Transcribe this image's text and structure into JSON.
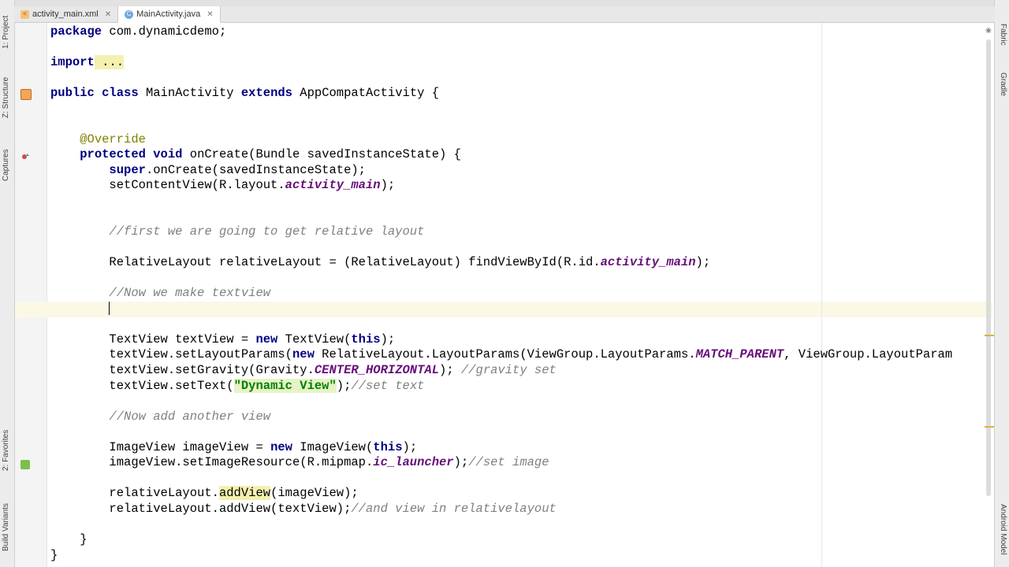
{
  "tabs": [
    {
      "label": "activity_main.xml",
      "icon": "xml-file-icon",
      "active": false
    },
    {
      "label": "MainActivity.java",
      "icon": "java-class-icon",
      "active": true
    }
  ],
  "left_tool_windows": [
    "1: Project",
    "Z: Structure",
    "Captures",
    "2: Favorites",
    "Build Variants"
  ],
  "right_tool_windows": [
    "Fabric",
    "Gradle",
    "Android Model"
  ],
  "code": {
    "l1_package": "package",
    "l1_name": " com.dynamicdemo;",
    "l2_import": "import",
    "l2_dots": " ...",
    "l3_public": "public",
    "l3_class": "class",
    "l3_name": " MainActivity ",
    "l3_extends": "extends",
    "l3_rest": " AppCompatActivity {",
    "l4_override": "@Override",
    "l5_protected": "protected",
    "l5_void": "void",
    "l5_rest": " onCreate(Bundle savedInstanceState) {",
    "l6_super": "super",
    "l6_rest": ".onCreate(savedInstanceState);",
    "l7_a": "setContentView(R.layout.",
    "l7_field": "activity_main",
    "l7_b": ");",
    "c1": "//first we are going to get relative layout",
    "l8_a": "RelativeLayout relativeLayout = (RelativeLayout) findViewById(R.id.",
    "l8_field": "activity_main",
    "l8_b": ");",
    "c2": "//Now we make textview",
    "l9_a": "TextView textView = ",
    "l9_new": "new",
    "l9_b": " TextView(",
    "l9_this": "this",
    "l9_c": ");",
    "l10_a": "textView.setLayoutParams(",
    "l10_new": "new",
    "l10_b": " RelativeLayout.LayoutParams(ViewGroup.LayoutParams.",
    "l10_field": "MATCH_PARENT",
    "l10_c": ", ViewGroup.LayoutParam",
    "l11_a": "textView.setGravity(Gravity.",
    "l11_field": "CENTER_HORIZONTAL",
    "l11_b": "); ",
    "l11_comment": "//gravity set",
    "l12_a": "textView.setText(",
    "l12_str": "\"Dynamic View\"",
    "l12_b": ");",
    "l12_comment": "//set text",
    "c3": "//Now add another view",
    "l13_a": "ImageView imageView = ",
    "l13_new": "new",
    "l13_b": " ImageView(",
    "l13_this": "this",
    "l13_c": ");",
    "l14_a": "imageView.setImageResource(R.mipmap.",
    "l14_field": "ic_launcher",
    "l14_b": ");",
    "l14_comment": "//set image",
    "l15_a": "relativeLayout.",
    "l15_hl": "addView",
    "l15_b": "(imageView);",
    "l16_a": "relativeLayout.addView(textView);",
    "l16_comment": "//and view in relativelayout",
    "close1": "}",
    "close2": "}"
  }
}
